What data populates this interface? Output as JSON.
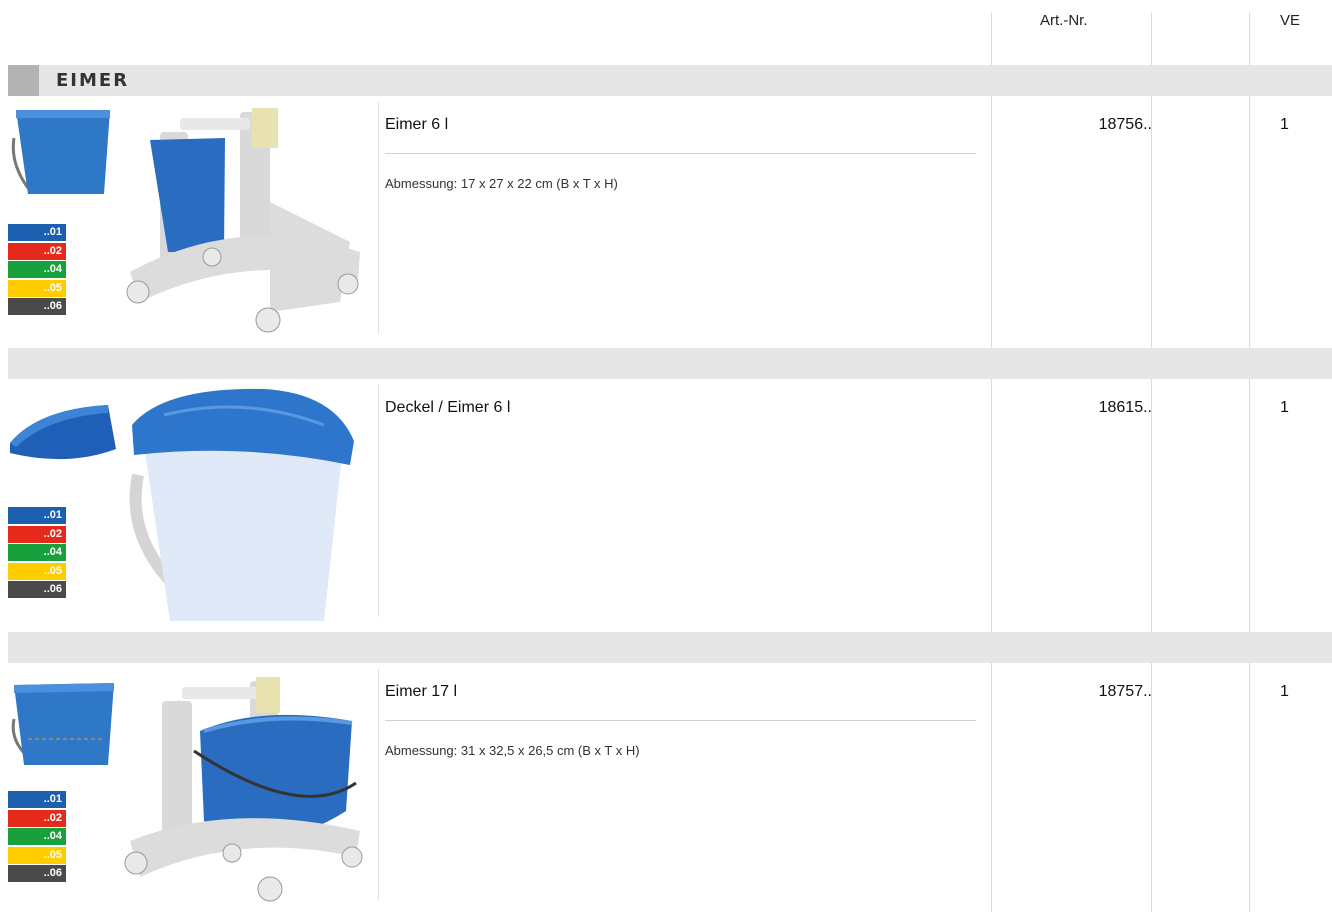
{
  "columns": {
    "artnr": "Art.-Nr.",
    "ve": "VE"
  },
  "section": {
    "title": "EIMER"
  },
  "color_codes": [
    {
      "code": "..01",
      "color": "#1b5fae"
    },
    {
      "code": "..02",
      "color": "#e52a1c"
    },
    {
      "code": "..04",
      "color": "#18a03c"
    },
    {
      "code": "..05",
      "color": "#ffcc00"
    },
    {
      "code": "..06",
      "color": "#4a4a4a"
    }
  ],
  "products": [
    {
      "name": "Eimer 6 l",
      "description": "Abmessung:  17 x 27 x 22 cm  (B x T x H)",
      "artnr": "18756..",
      "ve": "1"
    },
    {
      "name": "Deckel / Eimer 6 l",
      "description": "",
      "artnr": "18615..",
      "ve": "1"
    },
    {
      "name": "Eimer 17 l",
      "description": "Abmessung:  31 x 32,5 x 26,5 cm  (B x T x H)",
      "artnr": "18757..",
      "ve": "1"
    }
  ]
}
